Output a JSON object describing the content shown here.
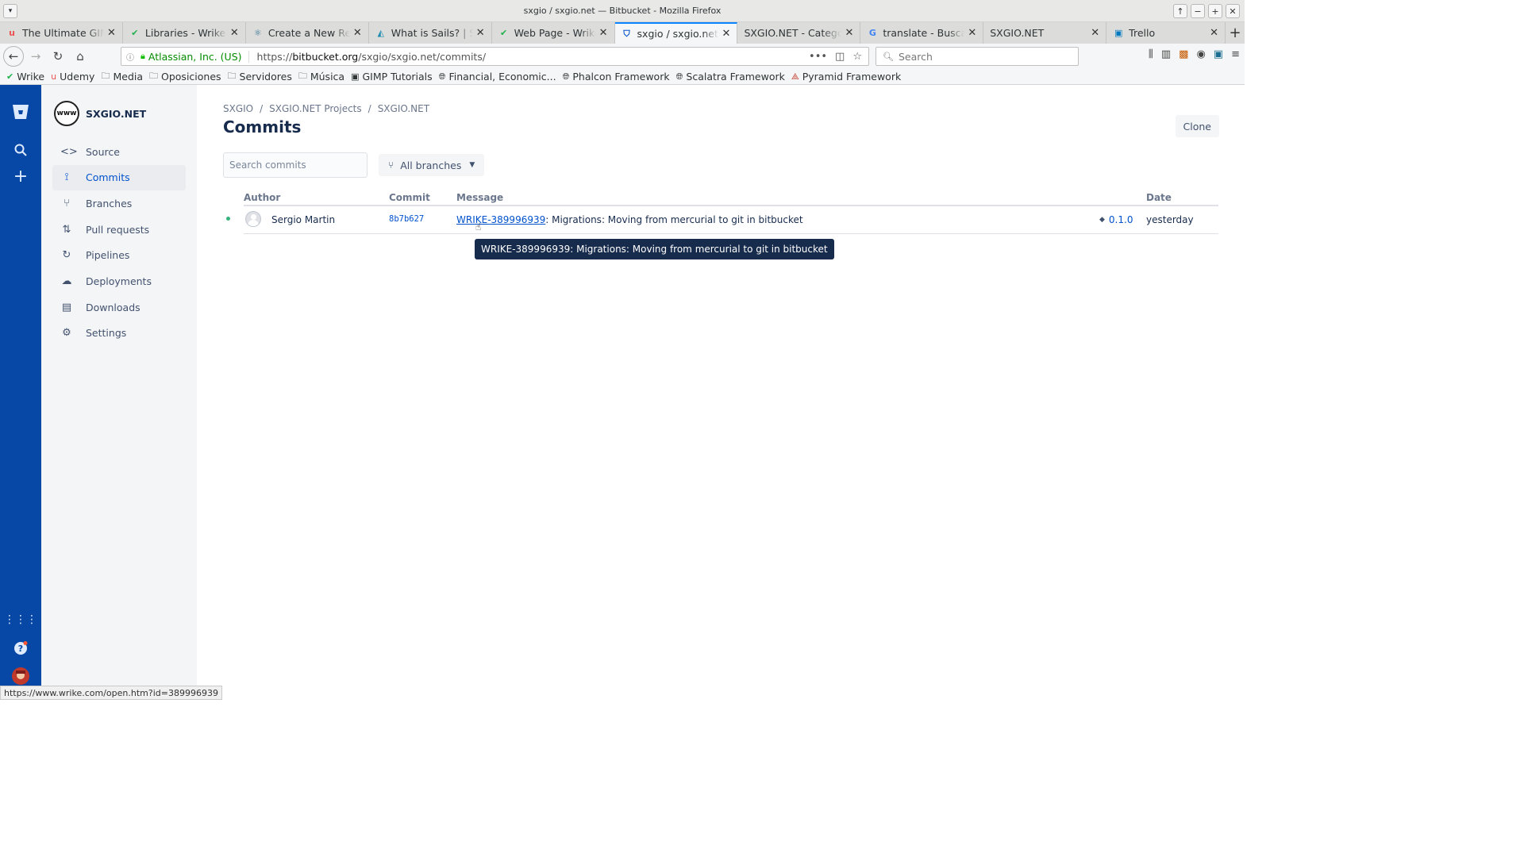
{
  "window": {
    "title": "sxgio / sxgio.net — Bitbucket - Mozilla Firefox"
  },
  "tabs": [
    {
      "label": "The Ultimate GIMP",
      "icon": "udemy-icon",
      "color": "#ec5252"
    },
    {
      "label": "Libraries - Wrike",
      "icon": "wrike-icon",
      "color": "#22b14c"
    },
    {
      "label": "Create a New React",
      "icon": "react-icon",
      "color": "#2a6e8f"
    },
    {
      "label": "What is Sails? | Sail",
      "icon": "sails-icon",
      "color": "#1d8ab0"
    },
    {
      "label": "Web Page - Wrike",
      "icon": "wrike-icon",
      "color": "#22b14c"
    },
    {
      "label": "sxgio / sxgio.net —",
      "icon": "bitbucket-icon",
      "color": "#0052cc",
      "active": true
    },
    {
      "label": "SXGIO.NET - Categorie",
      "icon": "",
      "color": ""
    },
    {
      "label": "translate - Buscar c",
      "icon": "google-icon",
      "color": "#4285f4"
    },
    {
      "label": "SXGIO.NET",
      "icon": "",
      "color": ""
    },
    {
      "label": "Trello",
      "icon": "trello-icon",
      "color": "#0079bf"
    }
  ],
  "nav": {
    "org": "Atlassian, Inc. (US)",
    "url_prefix": "https://",
    "url_host": "bitbucket.org",
    "url_path": "/sxgio/sxgio.net/commits/",
    "search_placeholder": "Search"
  },
  "bookmarks": [
    {
      "label": "Wrike",
      "icon": "wrike-icon"
    },
    {
      "label": "Udemy",
      "icon": "udemy-icon"
    },
    {
      "label": "Media",
      "icon": "folder-icon"
    },
    {
      "label": "Oposiciones",
      "icon": "folder-icon"
    },
    {
      "label": "Servidores",
      "icon": "folder-icon"
    },
    {
      "label": "Música",
      "icon": "folder-icon"
    },
    {
      "label": "GIMP Tutorials",
      "icon": "gimp-icon"
    },
    {
      "label": "Financial, Economic...",
      "icon": "globe-icon"
    },
    {
      "label": "Phalcon Framework",
      "icon": "globe-icon"
    },
    {
      "label": "Scalatra Framework",
      "icon": "globe-icon"
    },
    {
      "label": "Pyramid Framework",
      "icon": "pyramid-icon"
    }
  ],
  "project": {
    "name": "SXGIO.NET",
    "avatar_text": "www"
  },
  "sidebar": {
    "items": [
      {
        "label": "Source",
        "icon": "source-icon"
      },
      {
        "label": "Commits",
        "icon": "commits-icon",
        "active": true
      },
      {
        "label": "Branches",
        "icon": "branches-icon"
      },
      {
        "label": "Pull requests",
        "icon": "pull-requests-icon"
      },
      {
        "label": "Pipelines",
        "icon": "pipelines-icon"
      },
      {
        "label": "Deployments",
        "icon": "deployments-icon"
      },
      {
        "label": "Downloads",
        "icon": "downloads-icon"
      },
      {
        "label": "Settings",
        "icon": "settings-icon"
      }
    ]
  },
  "breadcrumb": [
    "SXGIO",
    "SXGIO.NET Projects",
    "SXGIO.NET"
  ],
  "page": {
    "title": "Commits",
    "clone_label": "Clone",
    "search_placeholder": "Search commits",
    "branches_label": "All branches"
  },
  "table": {
    "headers": {
      "author": "Author",
      "commit": "Commit",
      "message": "Message",
      "date": "Date"
    },
    "rows": [
      {
        "author": "Sergio Martin",
        "commit": "8b7b627",
        "issue_link": "WRIKE-389996939",
        "message_rest": ": Migrations: Moving from mercurial to git in bitbucket",
        "tag": "0.1.0",
        "date": "yesterday"
      }
    ]
  },
  "tooltip": {
    "text": "WRIKE-389996939: Migrations: Moving from mercurial to git in bitbucket"
  },
  "status": {
    "url": "https://www.wrike.com/open.htm?id=389996939"
  },
  "colors": {
    "global_nav": "#0747a6",
    "link": "#0052cc",
    "accent_tab": "#0a84ff"
  }
}
